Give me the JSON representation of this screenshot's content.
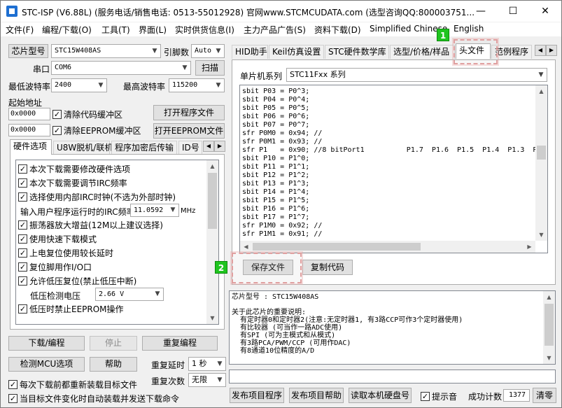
{
  "title_bar": {
    "title": "STC-ISP (V6.88L) (服务电话/销售电话: 0513-55012928) 官网www.STCMCUDATA.com  (选型咨询QQ:800003751...",
    "minimize": "—",
    "maximize": "☐",
    "close": "✕"
  },
  "menu": [
    "文件(F)",
    "编程/下载(O)",
    "工具(T)",
    "界面(L)",
    "实时供货信息(I)",
    "主力产品广告(S)",
    "资料下载(D)",
    "Simplified Chinese",
    "English"
  ],
  "left": {
    "chip_type_label": "芯片型号",
    "chip_type_value": "STC15W408AS",
    "pins_label": "引脚数",
    "pins_value": "Auto",
    "port_label": "串口",
    "port_value": "COM6",
    "scan_button": "扫描",
    "min_baud_label": "最低波特率",
    "min_baud_value": "2400",
    "max_baud_label": "最高波特率",
    "max_baud_value": "115200",
    "start_addr_label": "起始地址",
    "addr1_value": "0x0000",
    "clear_code_label": "清除代码缓冲区",
    "open_program_button": "打开程序文件",
    "addr2_value": "0x0000",
    "clear_eeprom_label": "清除EEPROM缓冲区",
    "open_eeprom_button": "打开EEPROM文件",
    "tabs": [
      "硬件选项",
      "U8W脱机/联机",
      "程序加密后传输",
      "ID号"
    ],
    "hw_options": [
      {
        "label": "本次下载需要修改硬件选项",
        "checked": true
      },
      {
        "label": "本次下载需要调节IRC频率",
        "checked": true
      },
      {
        "label": "选择使用内部IRC时钟(不选为外部时钟)",
        "checked": true
      }
    ],
    "irc_label": "输入用户程序运行时的IRC频率",
    "irc_value": "11.0592",
    "irc_unit": "MHz",
    "hw_options2": [
      {
        "label": "振荡器放大增益(12M以上建议选择)",
        "checked": true
      },
      {
        "label": "使用快速下载模式",
        "checked": true
      },
      {
        "label": "上电复位使用较长延时",
        "checked": true
      },
      {
        "label": "复位脚用作I/O口",
        "checked": true
      },
      {
        "label": "允许低压复位(禁止低压中断)",
        "checked": true
      }
    ],
    "low_voltage_label": "低压检测电压",
    "low_voltage_value": "2.66 V",
    "hw_option_last": {
      "label": "低压时禁止EEPROM操作",
      "checked": true
    },
    "download_button": "下载/编程",
    "stop_button": "停止",
    "reprogram_button": "重复编程",
    "detect_button": "检测MCU选项",
    "help_button": "帮助",
    "repeat_delay_label": "重复延时",
    "repeat_delay_value": "1 秒",
    "repeat_count_label": "重复次数",
    "repeat_count_value": "无限",
    "reload_label": "每次下载前都重新装载目标文件",
    "auto_load_label": "当目标文件变化时自动装载并发送下载命令"
  },
  "right": {
    "tabs": [
      "HID助手",
      "Keil仿真设置",
      "STC硬件数学库",
      "选型/价格/样品",
      "头文件",
      "范例程序"
    ],
    "active_tab": "头文件",
    "series_label": "单片机系列",
    "series_value": "STC11Fxx 系列",
    "code_lines": [
      "sbit P03 = P0^3;",
      "sbit P04 = P0^4;",
      "sbit P05 = P0^5;",
      "sbit P06 = P0^6;",
      "sbit P07 = P0^7;",
      "sfr P0M0 = 0x94; //",
      "sfr P0M1 = 0x93; //",
      "sfr P1   = 0x90; //8 bitPort1          P1.7  P1.6  P1.5  P1.4  P1.3  P",
      "sbit P10 = P1^0;",
      "sbit P11 = P1^1;",
      "sbit P12 = P1^2;",
      "sbit P13 = P1^3;",
      "sbit P14 = P1^4;",
      "sbit P15 = P1^5;",
      "sbit P16 = P1^6;",
      "sbit P17 = P1^7;",
      "sfr P1M0 = 0x92; //",
      "sfr P1M1 = 0x91; //"
    ],
    "save_button": "保存文件",
    "copy_button": "复制代码",
    "info_lines": [
      "芯片型号 : STC15W408AS",
      "",
      "关于此芯片的重要说明:",
      "  有定时器0和定时器2(注意:无定时器1, 有3路CCP可作3个定时器使用)",
      "  有比较器 (可当作一路ADC使用)",
      "  有SPI (可为主模式和从模式)",
      "  有3路PCA/PWM/CCP (可用作DAC)",
      "  有8通道10位精度的A/D"
    ],
    "publish_button": "发布项目程序",
    "publish_help_button": "发布项目帮助",
    "read_disk_button": "读取本机硬盘号",
    "sound_label": "提示音",
    "success_label": "成功计数",
    "success_value": "1377",
    "clear_button": "清零"
  },
  "callouts": {
    "one": "1",
    "two": "2"
  }
}
